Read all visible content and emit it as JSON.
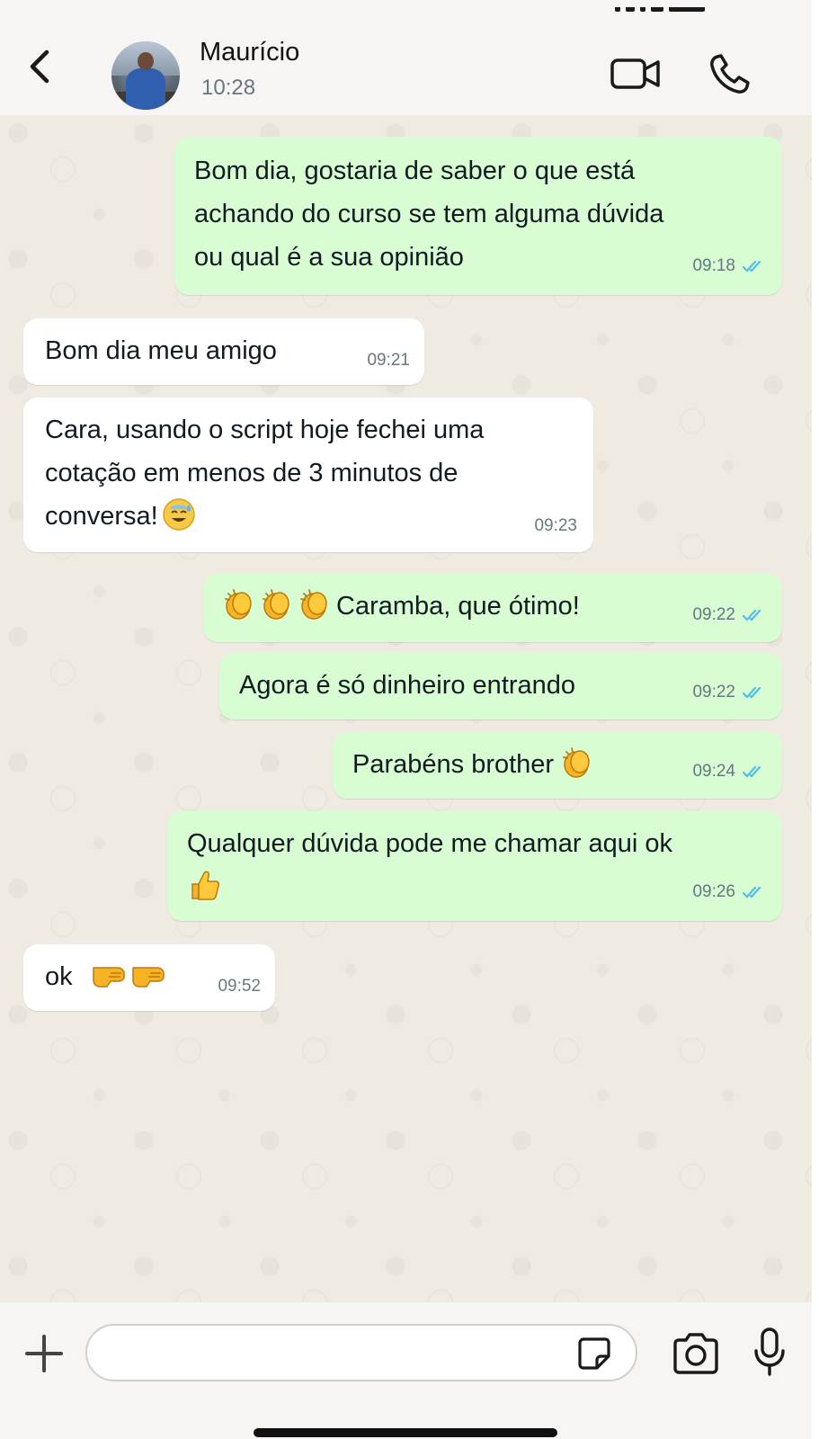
{
  "header": {
    "contact_name": "Maurício",
    "contact_status": "10:28",
    "icons": {
      "back": "chevron-left-icon",
      "video": "video-camera-icon",
      "call": "phone-icon"
    }
  },
  "messages": [
    {
      "direction": "out",
      "lines": [
        "Bom dia, gostaria de saber o que está",
        "achando do curso se tem alguma dúvida",
        "ou qual é a sua opinião"
      ],
      "time": "09:18",
      "read": true
    },
    {
      "direction": "in",
      "lines": [
        "Bom dia meu amigo"
      ],
      "time": "09:21"
    },
    {
      "direction": "in",
      "lines": [
        "Cara, usando o script hoje fechei uma",
        "cotação em menos de 3 minutos de",
        "conversa!"
      ],
      "trailing_emoji": "sweat-smile-emoji",
      "time": "09:23"
    },
    {
      "direction": "out",
      "leading_emoji": [
        "clapping-hands-emoji",
        "clapping-hands-emoji",
        "clapping-hands-emoji"
      ],
      "lines": [
        "Caramba, que ótimo!"
      ],
      "time": "09:22",
      "read": true
    },
    {
      "direction": "out",
      "lines": [
        "Agora é só dinheiro entrando"
      ],
      "time": "09:22",
      "read": true
    },
    {
      "direction": "out",
      "lines": [
        "Parabéns brother"
      ],
      "trailing_emoji": "clapping-hands-emoji",
      "time": "09:24",
      "read": true
    },
    {
      "direction": "out",
      "lines": [
        "Qualquer dúvida pode me chamar aqui ok"
      ],
      "second_line_emoji": "thumbs-up-emoji",
      "time": "09:26",
      "read": true
    },
    {
      "direction": "in",
      "lines": [
        "ok"
      ],
      "trailing_emoji": [
        "fist-bump-emoji",
        "fist-bump-emoji"
      ],
      "time": "09:52"
    }
  ],
  "composer": {
    "input_value": "",
    "placeholder": "",
    "icons": {
      "attach": "plus-icon",
      "sticker": "sticker-icon",
      "camera": "camera-icon",
      "mic": "microphone-icon"
    }
  },
  "colors": {
    "outgoing_bubble": "#d9fdd3",
    "incoming_bubble": "#ffffff",
    "read_ticks": "#53bdeb",
    "chat_background": "#efeae2",
    "header_background": "#f6f5f3"
  }
}
